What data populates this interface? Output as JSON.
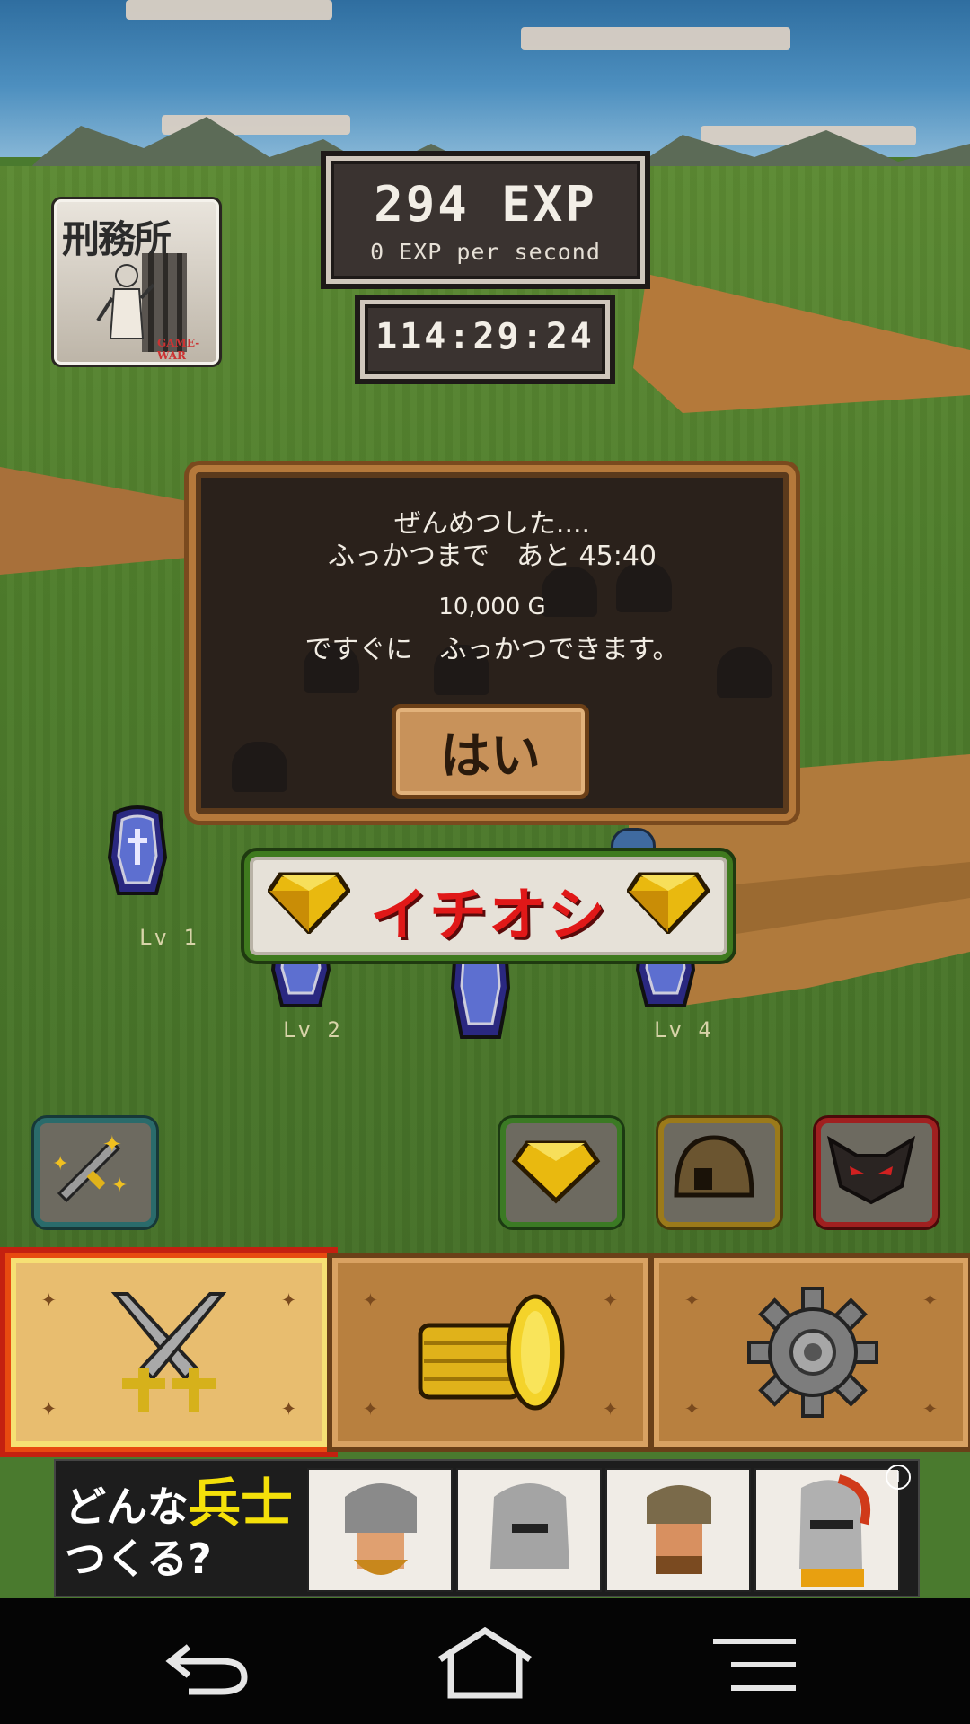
{
  "hud": {
    "exp_total": "294 EXP",
    "exp_rate": "0 EXP per second",
    "timer": "114:29:24"
  },
  "prison_button": {
    "title": "刑務所",
    "badge_text": "GAME-WAR"
  },
  "dialog": {
    "line1": "ぜんめつした....",
    "line2": "ふっかつまで　あと 45:40",
    "line3": "10,000 G",
    "line4": "ですぐに　ふっかつできます。",
    "yes_button": "はい"
  },
  "recommend_banner": {
    "label": "イチオシ"
  },
  "units": [
    {
      "level": "Lv 1"
    },
    {
      "level": "Lv 2"
    },
    {
      "level": "Lv 4"
    }
  ],
  "action_buttons": [
    {
      "icon": "sword-sparkle-icon"
    },
    {
      "icon": "gem-icon"
    },
    {
      "icon": "helmet-icon"
    },
    {
      "icon": "demon-mask-icon"
    }
  ],
  "bottom_tabs": [
    {
      "icon": "crossed-swords-icon",
      "active": true
    },
    {
      "icon": "gold-coins-icon",
      "active": false
    },
    {
      "icon": "gear-icon",
      "active": false
    }
  ],
  "ad": {
    "text_a": "どんな",
    "text_b": "兵士",
    "text_c": "つくる?",
    "info_glyph": "i"
  },
  "system_nav": [
    "back-icon",
    "home-icon",
    "menu-icon"
  ]
}
